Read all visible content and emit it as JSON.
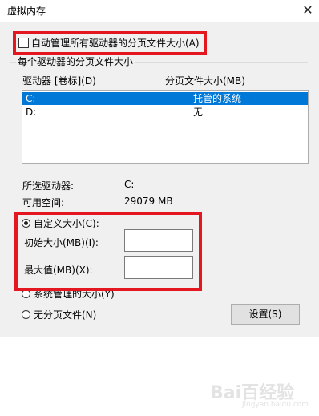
{
  "window": {
    "title": "虚拟内存",
    "close_glyph": "✕"
  },
  "auto_manage": {
    "label": "自动管理所有驱动器的分页文件大小(A)",
    "checked": false
  },
  "drives_group": {
    "title": "每个驱动器的分页文件大小",
    "columns": [
      "驱动器 [卷标](D)",
      "分页文件大小(MB)"
    ],
    "rows": [
      {
        "drive": "C:",
        "size": "托管的系统",
        "selected": true
      },
      {
        "drive": "D:",
        "size": "无",
        "selected": false
      }
    ],
    "selected_drive_label": "所选驱动器:",
    "selected_drive_value": "C:",
    "free_space_label": "可用空间:",
    "free_space_value": "29079 MB"
  },
  "options": {
    "custom_size": {
      "label": "自定义大小(C):",
      "selected": true
    },
    "initial_size": {
      "label": "初始大小(MB)(I):",
      "value": ""
    },
    "max_size": {
      "label": "最大值(MB)(X):",
      "value": ""
    },
    "system_managed": {
      "label": "系统管理的大小(Y)",
      "selected": false
    },
    "no_paging": {
      "label": "无分页文件(N)",
      "selected": false
    }
  },
  "buttons": {
    "set": "设置(S)"
  },
  "highlight_color": "#e4161f",
  "watermark": {
    "text": "Bai百经验",
    "sub": "jingyan.baidu.com"
  }
}
